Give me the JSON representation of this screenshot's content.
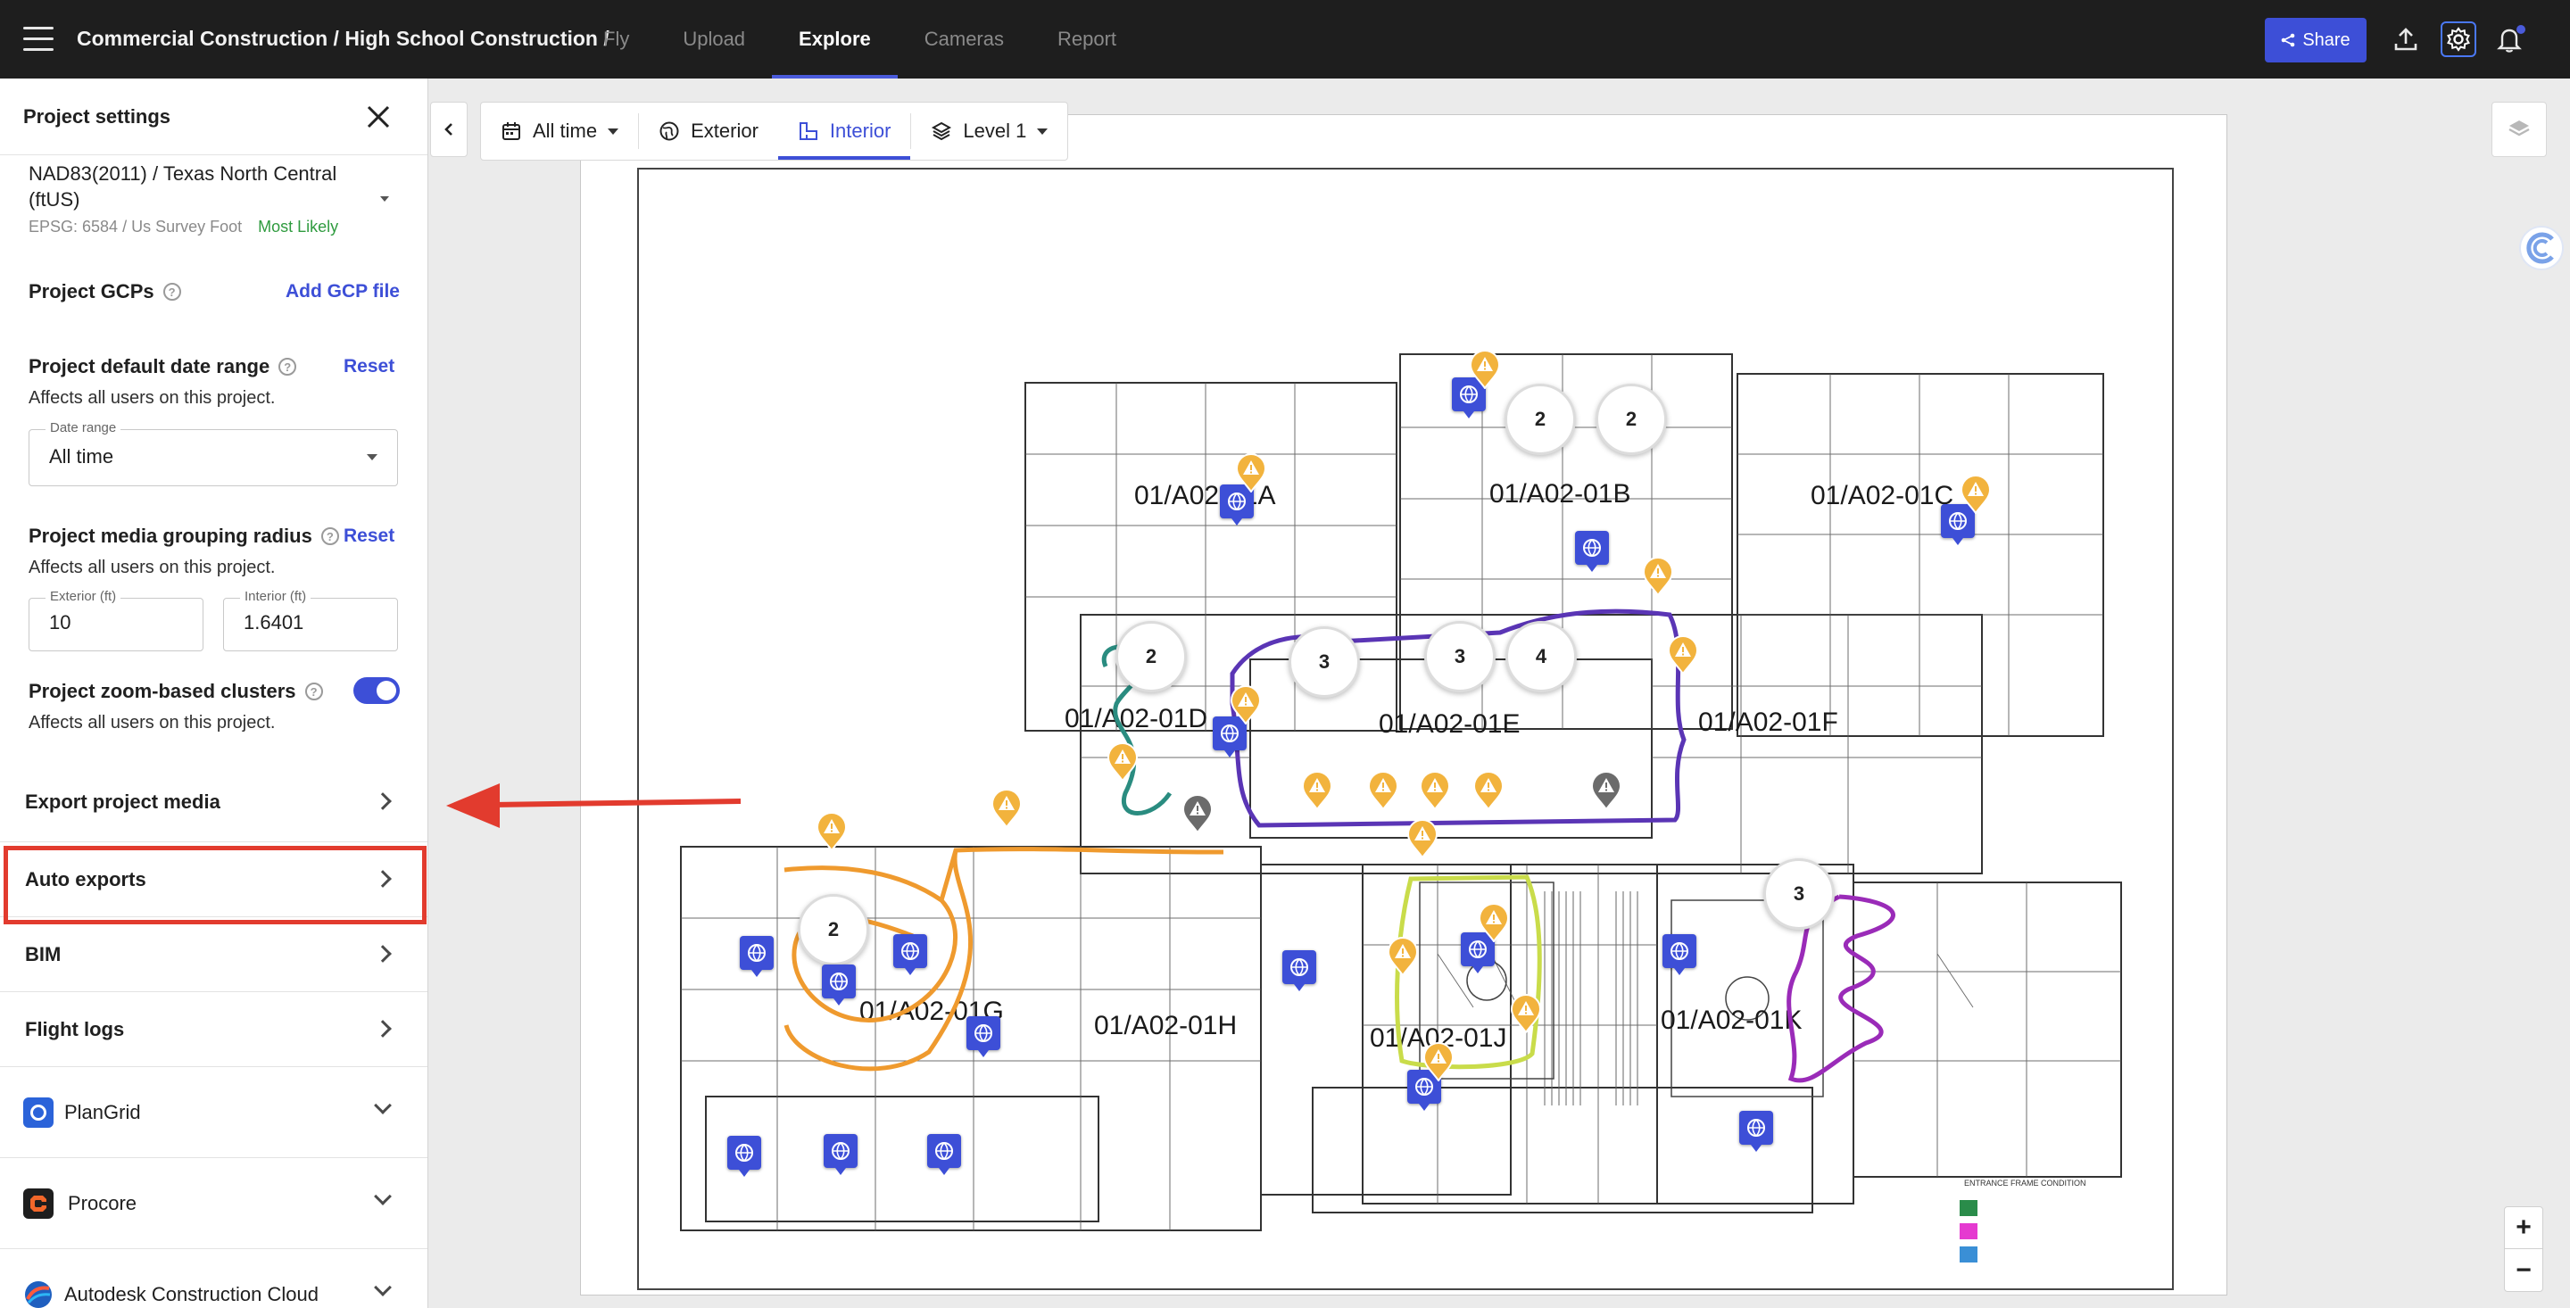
{
  "topbar": {
    "project_path": "Commercial Construction / High School Construction /",
    "tabs": [
      {
        "label": "Fly",
        "active": false
      },
      {
        "label": "Upload",
        "active": false
      },
      {
        "label": "Explore",
        "active": true
      },
      {
        "label": "Cameras",
        "active": false
      },
      {
        "label": "Report",
        "active": false
      }
    ],
    "share_label": "Share",
    "accent_color": "#3d4fd7"
  },
  "panel": {
    "title": "Project settings",
    "coordinate_system": {
      "name": "NAD83(2011) / Texas North Central (ftUS)",
      "sub": "EPSG: 6584 / Us Survey Foot",
      "likelihood": "Most Likely"
    },
    "gcps": {
      "label": "Project GCPs",
      "action": "Add GCP file"
    },
    "date_range": {
      "label": "Project default date range",
      "reset": "Reset",
      "desc": "Affects all users on this project.",
      "field_label": "Date range",
      "value": "All time"
    },
    "grouping_radius": {
      "label": "Project media grouping radius",
      "reset": "Reset",
      "desc": "Affects all users on this project.",
      "exterior_label": "Exterior (ft)",
      "exterior_value": "10",
      "interior_label": "Interior (ft)",
      "interior_value": "1.6401"
    },
    "zoom_clusters": {
      "label": "Project zoom-based clusters",
      "desc": "Affects all users on this project.",
      "enabled": true
    },
    "menu": [
      {
        "label": "Export project media"
      },
      {
        "label": "Auto exports"
      },
      {
        "label": "BIM"
      },
      {
        "label": "Flight logs"
      }
    ],
    "integrations": [
      {
        "label": "PlanGrid",
        "icon": "plangrid-icon"
      },
      {
        "label": "Procore",
        "icon": "procore-icon"
      },
      {
        "label": "Autodesk Construction Cloud",
        "icon": "autodesk-icon"
      }
    ]
  },
  "toolbar": {
    "time_filter": "All time",
    "exterior": "Exterior",
    "interior": "Interior",
    "level": "Level 1"
  },
  "map": {
    "room_labels": [
      "01/A02-01A",
      "01/A02-01B",
      "01/A02-01C",
      "01/A02-01D",
      "01/A02-01E",
      "01/A02-01F",
      "01/A02-01G",
      "01/A02-01H",
      "01/A02-01J",
      "01/A02-01K"
    ],
    "cluster_counts": [
      "2",
      "2",
      "2",
      "3",
      "3",
      "4",
      "2",
      "3"
    ],
    "zoom_in": "+",
    "zoom_out": "−",
    "legend_title": "ENTRANCE FRAME CONDITION",
    "route_colors": {
      "teal": "#2a8c80",
      "purple": "#5a35b5",
      "orange": "#ef9a2e",
      "lime": "#c9dc4a",
      "magenta": "#9a2bb8"
    }
  }
}
